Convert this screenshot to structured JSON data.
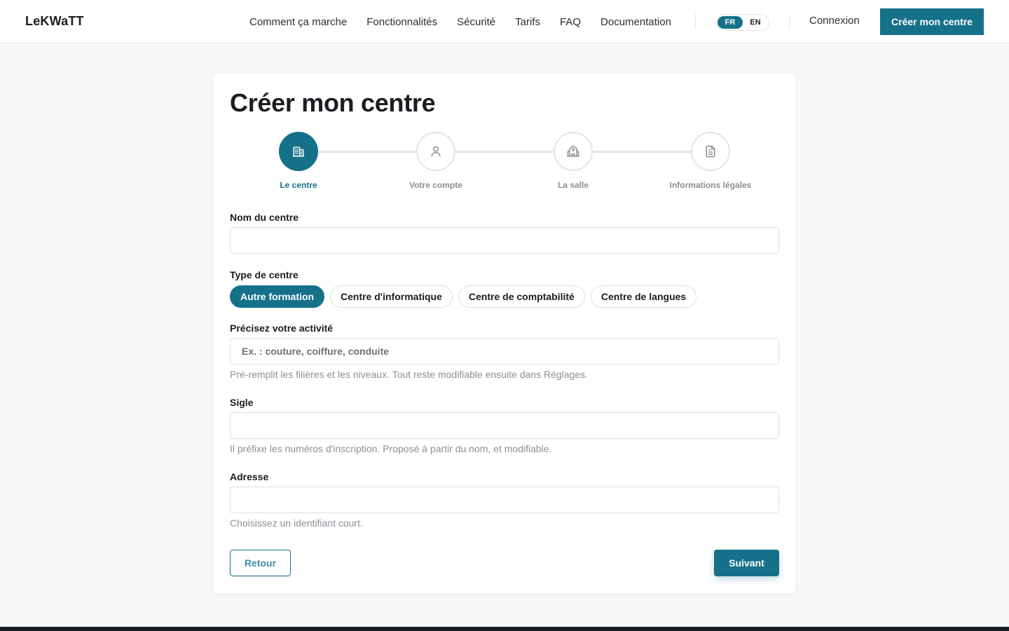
{
  "header": {
    "logo": "LeKWaTT",
    "nav": [
      "Comment ça marche",
      "Fonctionnalités",
      "Sécurité",
      "Tarifs",
      "FAQ",
      "Documentation"
    ],
    "lang": {
      "fr": "FR",
      "en": "EN",
      "active": "FR"
    },
    "login": "Connexion",
    "cta": "Créer mon centre"
  },
  "card": {
    "title": "Créer mon centre",
    "steps": [
      {
        "label": "Le centre",
        "icon": "building-icon",
        "active": true
      },
      {
        "label": "Votre compte",
        "icon": "user-icon",
        "active": false
      },
      {
        "label": "La salle",
        "icon": "school-icon",
        "active": false
      },
      {
        "label": "Informations légales",
        "icon": "document-icon",
        "active": false
      }
    ],
    "form": {
      "name": {
        "label": "Nom du centre",
        "value": "",
        "placeholder": ""
      },
      "type": {
        "label": "Type de centre",
        "options": [
          "Autre formation",
          "Centre d'informatique",
          "Centre de comptabilité",
          "Centre de langues"
        ],
        "selected": "Autre formation"
      },
      "activity": {
        "label": "Précisez votre activité",
        "placeholder": "Ex. : couture, coiffure, conduite",
        "hint": "Pré-remplit les filières et les niveaux. Tout reste modifiable ensuite dans Réglages."
      },
      "acronym": {
        "label": "Sigle",
        "value": "",
        "hint": "Il préfixe les numéros d'inscription. Proposé à partir du nom, et modifiable."
      },
      "address": {
        "label": "Adresse",
        "value": "",
        "hint": "Choisissez un identifiant court."
      }
    },
    "buttons": {
      "back": "Retour",
      "next": "Suivant"
    }
  },
  "colors": {
    "accent": "#15718a",
    "background": "#f7f7f8",
    "muted": "#8a9097"
  }
}
